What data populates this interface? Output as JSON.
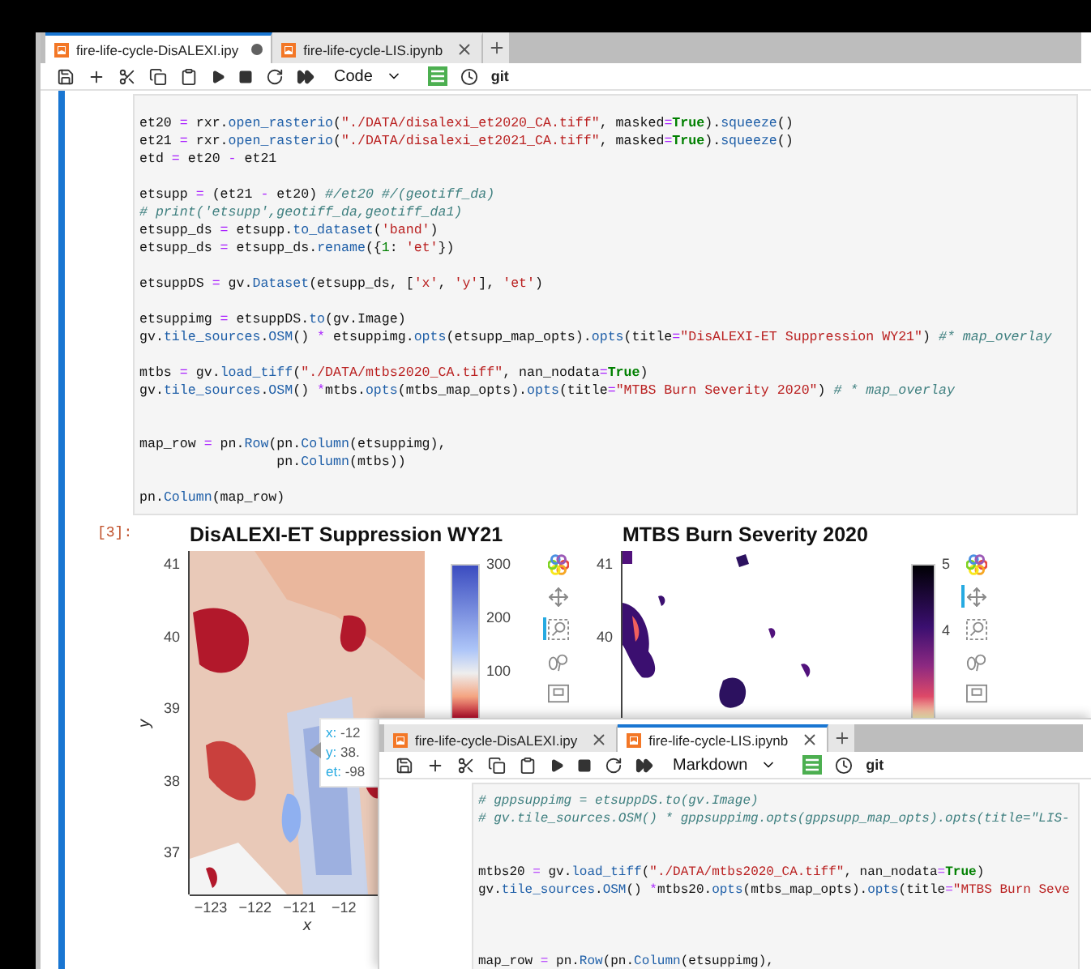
{
  "main_window": {
    "tabs": [
      {
        "label": "fire-life-cycle-DisALEXI.ipy",
        "selected": true,
        "modified": true
      },
      {
        "label": "fire-life-cycle-LIS.ipynb",
        "selected": false,
        "modified": false
      }
    ],
    "toolbar": {
      "cell_type": "Code",
      "git": "git"
    },
    "code_cell": {
      "lines": [
        {
          "kind": "code",
          "tokens": [
            {
              "kind": "n",
              "text": "et20 "
            },
            {
              "kind": "o",
              "text": "="
            },
            {
              "kind": "n",
              "text": " rxr."
            },
            {
              "kind": "f",
              "text": "open_rasterio"
            },
            {
              "kind": "n",
              "text": "("
            },
            {
              "kind": "s",
              "text": "\"./DATA/disalexi_et2020_CA.tiff\""
            },
            {
              "kind": "n",
              "text": ", masked"
            },
            {
              "kind": "o",
              "text": "="
            },
            {
              "kind": "k",
              "text": "True"
            },
            {
              "kind": "n",
              "text": ")."
            },
            {
              "kind": "f",
              "text": "squeeze"
            },
            {
              "kind": "n",
              "text": "()"
            }
          ]
        },
        {
          "kind": "code",
          "tokens": [
            {
              "kind": "n",
              "text": "et21 "
            },
            {
              "kind": "o",
              "text": "="
            },
            {
              "kind": "n",
              "text": " rxr."
            },
            {
              "kind": "f",
              "text": "open_rasterio"
            },
            {
              "kind": "n",
              "text": "("
            },
            {
              "kind": "s",
              "text": "\"./DATA/disalexi_et2021_CA.tiff\""
            },
            {
              "kind": "n",
              "text": ", masked"
            },
            {
              "kind": "o",
              "text": "="
            },
            {
              "kind": "k",
              "text": "True"
            },
            {
              "kind": "n",
              "text": ")."
            },
            {
              "kind": "f",
              "text": "squeeze"
            },
            {
              "kind": "n",
              "text": "()"
            }
          ]
        },
        {
          "kind": "code",
          "tokens": [
            {
              "kind": "n",
              "text": "etd "
            },
            {
              "kind": "o",
              "text": "="
            },
            {
              "kind": "n",
              "text": " et20 "
            },
            {
              "kind": "o",
              "text": "-"
            },
            {
              "kind": "n",
              "text": " et21"
            }
          ]
        },
        {
          "kind": "blank"
        },
        {
          "kind": "code",
          "tokens": [
            {
              "kind": "n",
              "text": "etsupp "
            },
            {
              "kind": "o",
              "text": "="
            },
            {
              "kind": "n",
              "text": " (et21 "
            },
            {
              "kind": "o",
              "text": "-"
            },
            {
              "kind": "n",
              "text": " et20) "
            },
            {
              "kind": "c",
              "text": "#/et20 #/(geotiff_da)"
            }
          ]
        },
        {
          "kind": "code",
          "tokens": [
            {
              "kind": "c",
              "text": "# print('etsupp',geotiff_da,geotiff_da1)"
            }
          ]
        },
        {
          "kind": "code",
          "tokens": [
            {
              "kind": "n",
              "text": "etsupp_ds "
            },
            {
              "kind": "o",
              "text": "="
            },
            {
              "kind": "n",
              "text": " etsupp."
            },
            {
              "kind": "f",
              "text": "to_dataset"
            },
            {
              "kind": "n",
              "text": "("
            },
            {
              "kind": "s",
              "text": "'band'"
            },
            {
              "kind": "n",
              "text": ")"
            }
          ]
        },
        {
          "kind": "code",
          "tokens": [
            {
              "kind": "n",
              "text": "etsupp_ds "
            },
            {
              "kind": "o",
              "text": "="
            },
            {
              "kind": "n",
              "text": " etsupp_ds."
            },
            {
              "kind": "f",
              "text": "rename"
            },
            {
              "kind": "n",
              "text": "({"
            },
            {
              "kind": "m",
              "text": "1"
            },
            {
              "kind": "n",
              "text": ": "
            },
            {
              "kind": "s",
              "text": "'et'"
            },
            {
              "kind": "n",
              "text": "})"
            }
          ]
        },
        {
          "kind": "blank"
        },
        {
          "kind": "code",
          "tokens": [
            {
              "kind": "n",
              "text": "etsuppDS "
            },
            {
              "kind": "o",
              "text": "="
            },
            {
              "kind": "n",
              "text": " gv."
            },
            {
              "kind": "f",
              "text": "Dataset"
            },
            {
              "kind": "n",
              "text": "(etsupp_ds, ["
            },
            {
              "kind": "s",
              "text": "'x'"
            },
            {
              "kind": "n",
              "text": ", "
            },
            {
              "kind": "s",
              "text": "'y'"
            },
            {
              "kind": "n",
              "text": "], "
            },
            {
              "kind": "s",
              "text": "'et'"
            },
            {
              "kind": "n",
              "text": ")"
            }
          ]
        },
        {
          "kind": "blank"
        },
        {
          "kind": "code",
          "tokens": [
            {
              "kind": "n",
              "text": "etsuppimg "
            },
            {
              "kind": "o",
              "text": "="
            },
            {
              "kind": "n",
              "text": " etsuppDS."
            },
            {
              "kind": "f",
              "text": "to"
            },
            {
              "kind": "n",
              "text": "(gv.Image)"
            }
          ]
        },
        {
          "kind": "code",
          "tokens": [
            {
              "kind": "n",
              "text": "gv."
            },
            {
              "kind": "f",
              "text": "tile_sources"
            },
            {
              "kind": "n",
              "text": "."
            },
            {
              "kind": "f",
              "text": "OSM"
            },
            {
              "kind": "n",
              "text": "() "
            },
            {
              "kind": "o",
              "text": "*"
            },
            {
              "kind": "n",
              "text": " etsuppimg."
            },
            {
              "kind": "f",
              "text": "opts"
            },
            {
              "kind": "n",
              "text": "(etsupp_map_opts)."
            },
            {
              "kind": "f",
              "text": "opts"
            },
            {
              "kind": "n",
              "text": "(title"
            },
            {
              "kind": "o",
              "text": "="
            },
            {
              "kind": "s",
              "text": "\"DisALEXI-ET Suppression WY21\""
            },
            {
              "kind": "n",
              "text": ") "
            },
            {
              "kind": "c",
              "text": "#* map_overlay"
            }
          ]
        },
        {
          "kind": "blank"
        },
        {
          "kind": "code",
          "tokens": [
            {
              "kind": "n",
              "text": "mtbs "
            },
            {
              "kind": "o",
              "text": "="
            },
            {
              "kind": "n",
              "text": " gv."
            },
            {
              "kind": "f",
              "text": "load_tiff"
            },
            {
              "kind": "n",
              "text": "("
            },
            {
              "kind": "s",
              "text": "\"./DATA/mtbs2020_CA.tiff\""
            },
            {
              "kind": "n",
              "text": ", nan_nodata"
            },
            {
              "kind": "o",
              "text": "="
            },
            {
              "kind": "k",
              "text": "True"
            },
            {
              "kind": "n",
              "text": ")"
            }
          ]
        },
        {
          "kind": "code",
          "tokens": [
            {
              "kind": "n",
              "text": "gv."
            },
            {
              "kind": "f",
              "text": "tile_sources"
            },
            {
              "kind": "n",
              "text": "."
            },
            {
              "kind": "f",
              "text": "OSM"
            },
            {
              "kind": "n",
              "text": "() "
            },
            {
              "kind": "o",
              "text": "*"
            },
            {
              "kind": "n",
              "text": "mtbs."
            },
            {
              "kind": "f",
              "text": "opts"
            },
            {
              "kind": "n",
              "text": "(mtbs_map_opts)."
            },
            {
              "kind": "f",
              "text": "opts"
            },
            {
              "kind": "n",
              "text": "(title"
            },
            {
              "kind": "o",
              "text": "="
            },
            {
              "kind": "s",
              "text": "\"MTBS Burn Severity 2020\""
            },
            {
              "kind": "n",
              "text": ") "
            },
            {
              "kind": "c",
              "text": "# * map_overlay"
            }
          ]
        },
        {
          "kind": "blank"
        },
        {
          "kind": "blank"
        },
        {
          "kind": "code",
          "tokens": [
            {
              "kind": "n",
              "text": "map_row "
            },
            {
              "kind": "o",
              "text": "="
            },
            {
              "kind": "n",
              "text": " pn."
            },
            {
              "kind": "f",
              "text": "Row"
            },
            {
              "kind": "n",
              "text": "(pn."
            },
            {
              "kind": "f",
              "text": "Column"
            },
            {
              "kind": "n",
              "text": "(etsuppimg),"
            }
          ]
        },
        {
          "kind": "code",
          "tokens": [
            {
              "kind": "n",
              "text": "                 pn."
            },
            {
              "kind": "f",
              "text": "Column"
            },
            {
              "kind": "n",
              "text": "(mtbs))"
            }
          ]
        },
        {
          "kind": "blank"
        },
        {
          "kind": "code",
          "tokens": [
            {
              "kind": "n",
              "text": "pn."
            },
            {
              "kind": "f",
              "text": "Column"
            },
            {
              "kind": "n",
              "text": "(map_row)"
            }
          ]
        }
      ]
    },
    "output_cell": {
      "prompt": "[3]:",
      "plots": [
        {
          "kind": "diverging",
          "title": "DisALEXI-ET Suppression WY21",
          "y_label": "y",
          "x_label": "x",
          "y_ticks": [
            "41",
            "40",
            "39",
            "38",
            "37"
          ],
          "x_ticks": [
            "−123",
            "−122",
            "−121",
            "−12"
          ],
          "colorbar_ticks": [
            "300",
            "200",
            "100"
          ],
          "tools": [
            {
              "kind": "logo",
              "selected": false
            },
            {
              "kind": "pan",
              "selected": false
            },
            {
              "kind": "box_zoom",
              "selected": true
            },
            {
              "kind": "wheel_zoom",
              "selected": false
            },
            {
              "kind": "save",
              "selected": false
            }
          ],
          "tooltip": [
            {
              "label": "x:",
              "value": " -12"
            },
            {
              "label": "y:",
              "value": " 38."
            },
            {
              "label": "et:",
              "value": " -98"
            }
          ]
        },
        {
          "kind": "sequential",
          "title": "MTBS Burn Severity 2020",
          "y_ticks": [
            "41",
            "40"
          ],
          "colorbar_ticks": [
            "5",
            "4"
          ],
          "tools": [
            {
              "kind": "logo",
              "selected": false
            },
            {
              "kind": "pan",
              "selected": true
            },
            {
              "kind": "box_zoom",
              "selected": false
            },
            {
              "kind": "wheel_zoom",
              "selected": false
            },
            {
              "kind": "save",
              "selected": false
            }
          ]
        }
      ]
    }
  },
  "second_window": {
    "tabs": [
      {
        "label": "fire-life-cycle-DisALEXI.ipy",
        "selected": false,
        "modified": false
      },
      {
        "label": "fire-life-cycle-LIS.ipynb",
        "selected": true,
        "modified": false
      }
    ],
    "toolbar": {
      "cell_type": "Markdown",
      "git": "git"
    },
    "code_lines": [
      {
        "kind": "code",
        "tokens": [
          {
            "kind": "c",
            "text": "# gppsuppimg = etsuppDS.to(gv.Image)"
          }
        ]
      },
      {
        "kind": "code",
        "tokens": [
          {
            "kind": "c",
            "text": "# gv.tile_sources.OSM() * gppsuppimg.opts(gppsupp_map_opts).opts(title=\"LIS-"
          }
        ]
      },
      {
        "kind": "blank"
      },
      {
        "kind": "blank"
      },
      {
        "kind": "code",
        "tokens": [
          {
            "kind": "n",
            "text": "mtbs20 "
          },
          {
            "kind": "o",
            "text": "="
          },
          {
            "kind": "n",
            "text": " gv."
          },
          {
            "kind": "f",
            "text": "load_tiff"
          },
          {
            "kind": "n",
            "text": "("
          },
          {
            "kind": "s",
            "text": "\"./DATA/mtbs2020_CA.tiff\""
          },
          {
            "kind": "n",
            "text": ", nan_nodata"
          },
          {
            "kind": "o",
            "text": "="
          },
          {
            "kind": "k",
            "text": "True"
          },
          {
            "kind": "n",
            "text": ")"
          }
        ]
      },
      {
        "kind": "code",
        "tokens": [
          {
            "kind": "n",
            "text": "gv."
          },
          {
            "kind": "f",
            "text": "tile_sources"
          },
          {
            "kind": "n",
            "text": "."
          },
          {
            "kind": "f",
            "text": "OSM"
          },
          {
            "kind": "n",
            "text": "() "
          },
          {
            "kind": "o",
            "text": "*"
          },
          {
            "kind": "n",
            "text": "mtbs20."
          },
          {
            "kind": "f",
            "text": "opts"
          },
          {
            "kind": "n",
            "text": "(mtbs_map_opts)."
          },
          {
            "kind": "f",
            "text": "opts"
          },
          {
            "kind": "n",
            "text": "(title"
          },
          {
            "kind": "o",
            "text": "="
          },
          {
            "kind": "s",
            "text": "\"MTBS Burn Seve"
          }
        ]
      },
      {
        "kind": "blank"
      },
      {
        "kind": "blank"
      },
      {
        "kind": "blank"
      },
      {
        "kind": "code",
        "tokens": [
          {
            "kind": "n",
            "text": "map_row "
          },
          {
            "kind": "o",
            "text": "="
          },
          {
            "kind": "n",
            "text": " pn."
          },
          {
            "kind": "f",
            "text": "Row"
          },
          {
            "kind": "n",
            "text": "(pn."
          },
          {
            "kind": "f",
            "text": "Column"
          },
          {
            "kind": "n",
            "text": "(etsuppimg),"
          }
        ]
      }
    ]
  }
}
